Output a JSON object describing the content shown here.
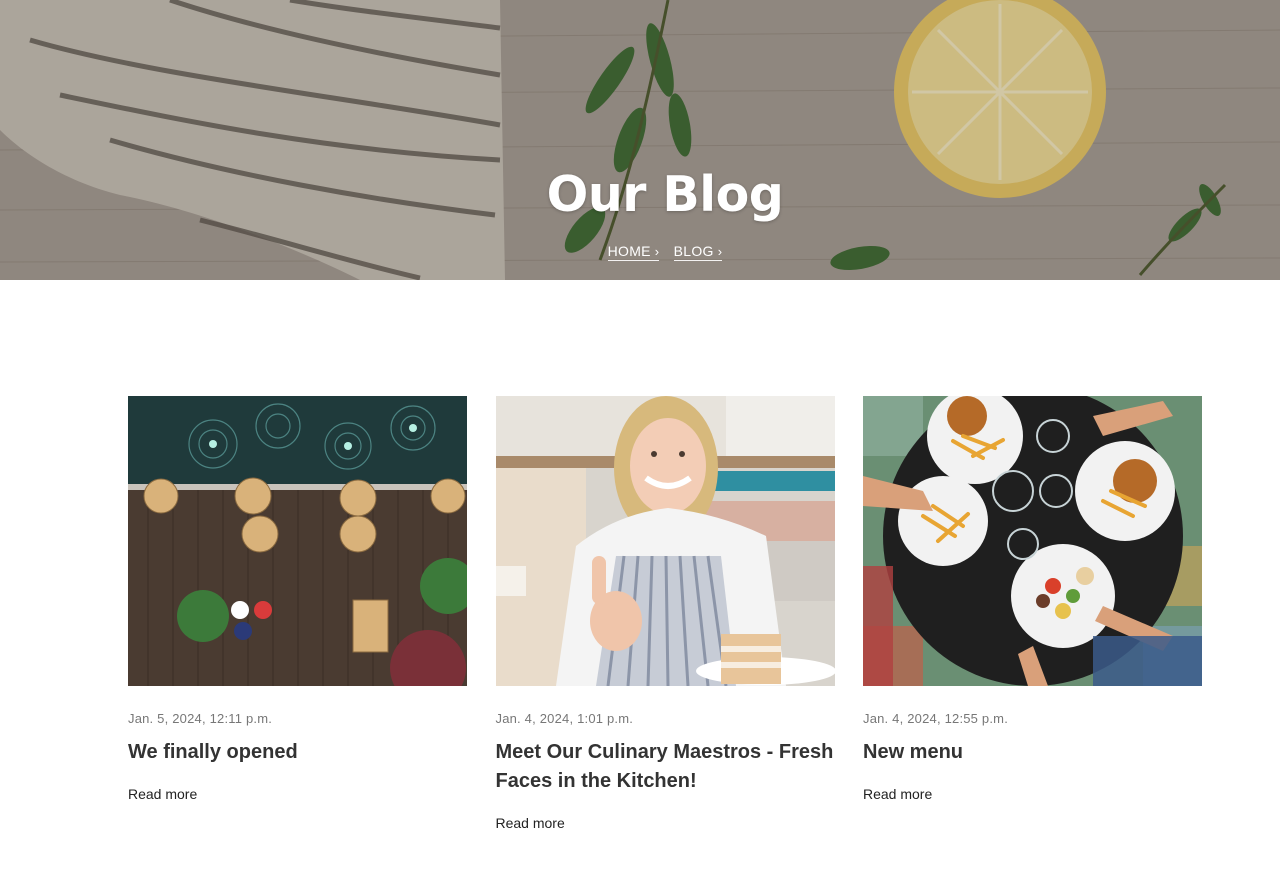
{
  "hero": {
    "title": "Our Blog",
    "breadcrumb": [
      {
        "label": "HOME",
        "chevron": "›"
      },
      {
        "label": "BLOG",
        "chevron": "›"
      }
    ]
  },
  "posts": [
    {
      "date": "Jan. 5, 2024, 12:11 p.m.",
      "title": "We finally opened",
      "read_more": "Read more",
      "image": "restaurant-patio-aerial-photo"
    },
    {
      "date": "Jan. 4, 2024, 1:01 p.m.",
      "title": "Meet Our Culinary Maestros - Fresh Faces in the Kitchen!",
      "read_more": "Read more",
      "image": "smiling-chef-with-cake-photo"
    },
    {
      "date": "Jan. 4, 2024, 12:55 p.m.",
      "title": "New menu",
      "read_more": "Read more",
      "image": "table-of-burgers-and-fries-photo"
    }
  ],
  "colors": {
    "text_dark": "#333333",
    "text_muted": "#777777",
    "hero_text": "#ffffff"
  }
}
